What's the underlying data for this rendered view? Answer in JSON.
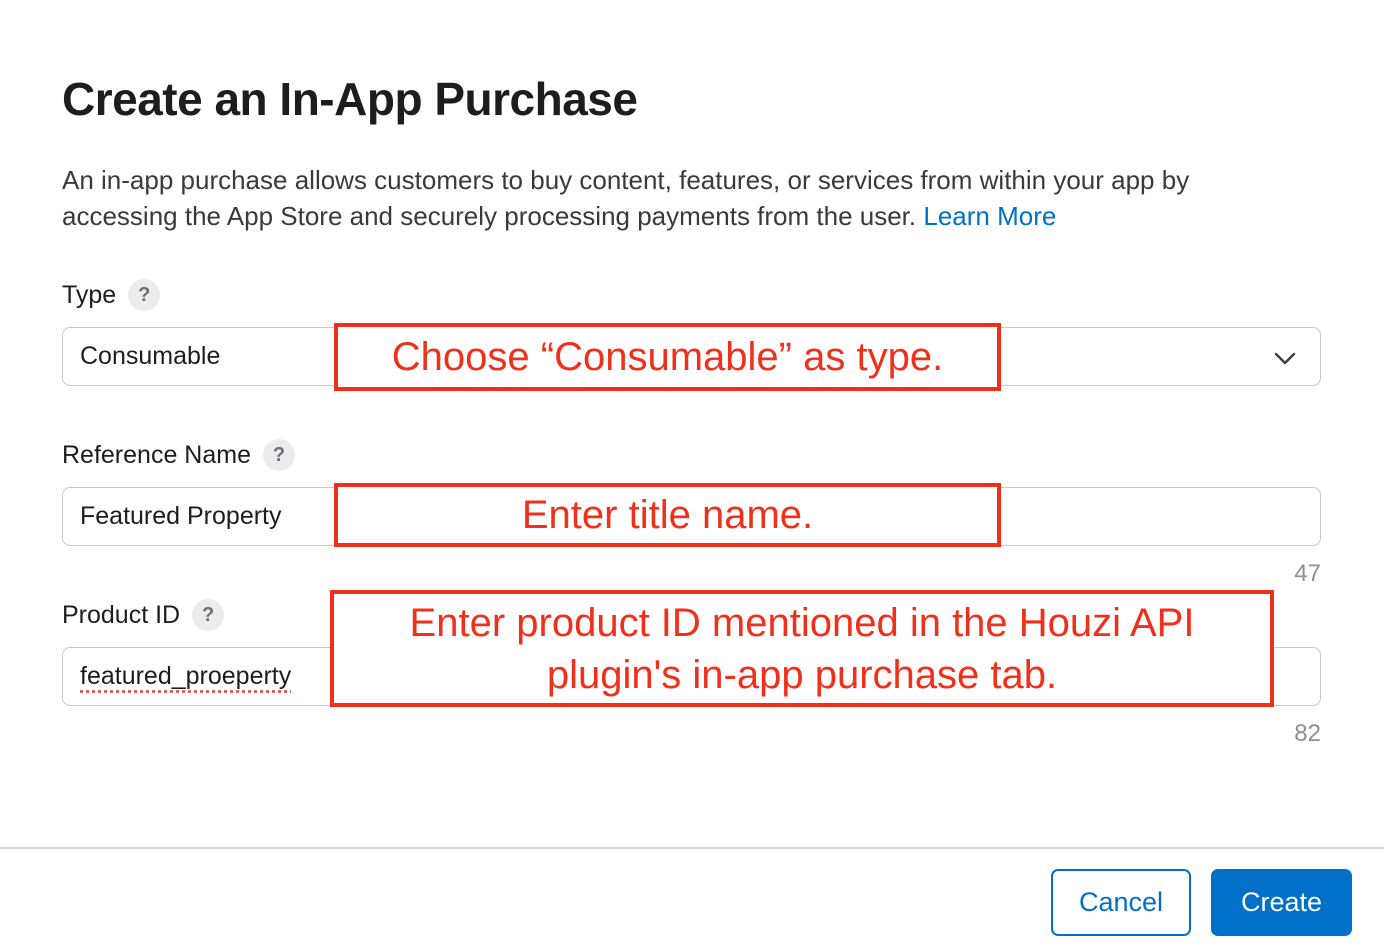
{
  "dialog": {
    "title": "Create an In-App Purchase",
    "description": "An in-app purchase allows customers to buy content, features, or services from within your app by accessing the App Store and securely processing payments from the user.",
    "learn_more": "Learn More"
  },
  "fields": {
    "type": {
      "label": "Type",
      "help": "?",
      "value": "Consumable",
      "icon": "chevron-down-icon"
    },
    "reference_name": {
      "label": "Reference Name",
      "help": "?",
      "value": "Featured Property",
      "remaining": "47"
    },
    "product_id": {
      "label": "Product ID",
      "help": "?",
      "value": "featured_proeperty",
      "remaining": "82"
    }
  },
  "annotations": {
    "type_note": "Choose “Consumable” as type.",
    "name_note": "Enter title name.",
    "product_note_line1": "Enter product ID mentioned in the Houzi API",
    "product_note_line2": "plugin's in-app purchase tab."
  },
  "footer": {
    "cancel_label": "Cancel",
    "create_label": "Create"
  },
  "colors": {
    "accent": "#0070c9",
    "annotation": "#f0301a",
    "text": "#1d1d1f",
    "muted": "#8e8e93"
  }
}
